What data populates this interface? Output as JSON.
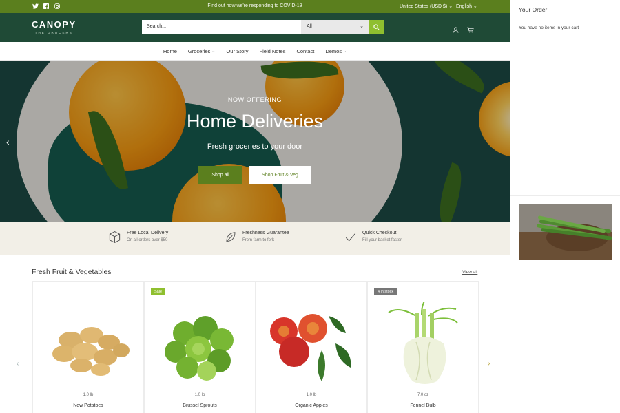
{
  "announcement": {
    "message": "Find out how we're responding to COVID-19",
    "currency": "United States (USD $)",
    "language": "English",
    "social_icons": [
      "twitter-icon",
      "facebook-icon",
      "instagram-icon"
    ]
  },
  "header": {
    "logo_name": "CANOPY",
    "logo_sub": "THE GROCERS",
    "search_placeholder": "Search...",
    "search_category": "All",
    "icons": [
      "account-icon",
      "cart-icon"
    ]
  },
  "nav": {
    "items": [
      {
        "label": "Home",
        "has_menu": false
      },
      {
        "label": "Groceries",
        "has_menu": true
      },
      {
        "label": "Our Story",
        "has_menu": false
      },
      {
        "label": "Field Notes",
        "has_menu": false
      },
      {
        "label": "Contact",
        "has_menu": false
      },
      {
        "label": "Demos",
        "has_menu": true
      }
    ]
  },
  "hero": {
    "kicker": "NOW OFFERING",
    "title": "Home Deliveries",
    "subtitle": "Fresh groceries to your door",
    "button_primary": "Shop all",
    "button_secondary": "Shop Fruit & Veg"
  },
  "features": [
    {
      "icon": "box-icon",
      "title": "Free Local Delivery",
      "detail": "On all orders over $50"
    },
    {
      "icon": "leaf-icon",
      "title": "Freshness Guarantee",
      "detail": "From farm to fork"
    },
    {
      "icon": "checkmark-icon",
      "title": "Quick Checkout",
      "detail": "Fill your basket faster"
    }
  ],
  "products_section": {
    "title": "Fresh Fruit & Vegetables",
    "view_all": "View all",
    "products": [
      {
        "name": "New Potatoes",
        "weight": "1.0 lb",
        "badge": ""
      },
      {
        "name": "Brussel Sprouts",
        "weight": "1.0 lb",
        "badge": "Sale"
      },
      {
        "name": "Organic Apples",
        "weight": "1.0 lb",
        "badge": ""
      },
      {
        "name": "Fennel Bulb",
        "weight": "7.0 oz",
        "badge": "4 in stock"
      }
    ]
  },
  "cart": {
    "title": "Your Order",
    "empty_message": "You have no items in your cart"
  },
  "colors": {
    "announcement_bar": "#5b7f1e",
    "header": "#1f4a36",
    "search_button": "#8fbf2f",
    "sale_badge": "#8fbf2f",
    "stock_badge": "#777777",
    "feature_band": "#f2efe7"
  }
}
